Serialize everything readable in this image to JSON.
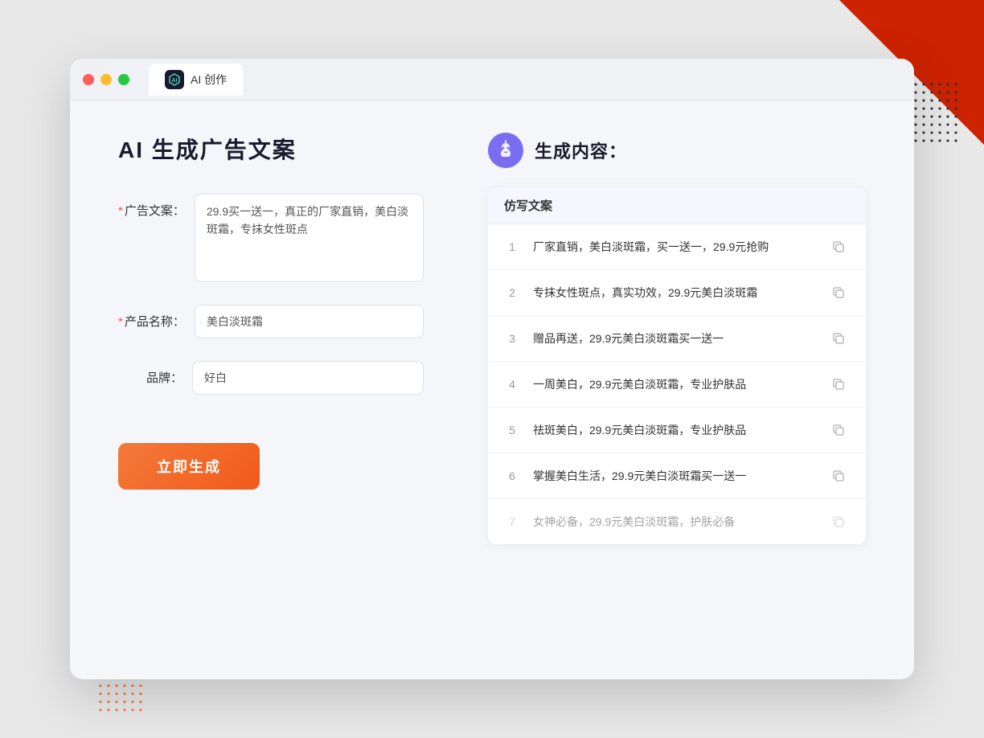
{
  "window": {
    "tab_label": "AI 创作",
    "controls": {
      "close": "close",
      "minimize": "minimize",
      "maximize": "maximize"
    }
  },
  "left_panel": {
    "title": "AI 生成广告文案",
    "form": {
      "ad_copy_label": "广告文案：",
      "ad_copy_required": "*",
      "ad_copy_value": "29.9买一送一，真正的厂家直销，美白淡斑霜，专抹女性斑点",
      "product_name_label": "产品名称：",
      "product_name_required": "*",
      "product_name_value": "美白淡斑霜",
      "brand_label": "品牌：",
      "brand_value": "好白",
      "submit_label": "立即生成"
    }
  },
  "right_panel": {
    "title": "生成内容：",
    "table_header": "仿写文案",
    "results": [
      {
        "number": "1",
        "text": "厂家直销，美白淡斑霜，买一送一，29.9元抢购",
        "faded": false
      },
      {
        "number": "2",
        "text": "专抹女性斑点，真实功效，29.9元美白淡斑霜",
        "faded": false
      },
      {
        "number": "3",
        "text": "赠品再送，29.9元美白淡斑霜买一送一",
        "faded": false
      },
      {
        "number": "4",
        "text": "一周美白，29.9元美白淡斑霜，专业护肤品",
        "faded": false
      },
      {
        "number": "5",
        "text": "祛斑美白，29.9元美白淡斑霜，专业护肤品",
        "faded": false
      },
      {
        "number": "6",
        "text": "掌握美白生活，29.9元美白淡斑霜买一送一",
        "faded": false
      },
      {
        "number": "7",
        "text": "女神必备，29.9元美白淡斑霜，护肤必备",
        "faded": true
      }
    ]
  },
  "colors": {
    "accent_orange": "#f47a3a",
    "accent_purple": "#7a6ef0",
    "required_red": "#ff4d4f"
  }
}
